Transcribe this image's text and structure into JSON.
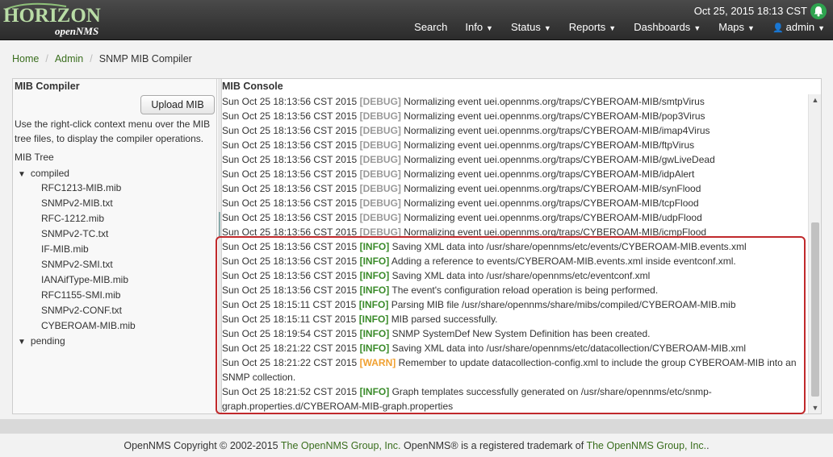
{
  "brand": {
    "logo_main": "HORIZON",
    "logo_sub": "openNMS"
  },
  "header": {
    "datetime": "Oct 25, 2015 18:13 CST",
    "nav": [
      {
        "label": "Search",
        "dropdown": false
      },
      {
        "label": "Info",
        "dropdown": true
      },
      {
        "label": "Status",
        "dropdown": true
      },
      {
        "label": "Reports",
        "dropdown": true
      },
      {
        "label": "Dashboards",
        "dropdown": true
      },
      {
        "label": "Maps",
        "dropdown": true
      },
      {
        "label": "admin",
        "dropdown": true,
        "icon": "user-icon"
      }
    ],
    "notification_icon": "bell-icon",
    "notification_color": "#2ea44f"
  },
  "breadcrumb": {
    "home": "Home",
    "admin": "Admin",
    "current": "SNMP MIB Compiler",
    "separator": "/"
  },
  "mib_panel": {
    "title": "MIB Compiler",
    "upload_label": "Upload MIB",
    "instructions": "Use the right-click context menu over the MIB tree files, to display the compiler operations.",
    "tree_label": "MIB Tree",
    "compiled_label": "compiled",
    "pending_label": "pending",
    "compiled_files": [
      "RFC1213-MIB.mib",
      "SNMPv2-MIB.txt",
      "RFC-1212.mib",
      "SNMPv2-TC.txt",
      "IF-MIB.mib",
      "SNMPv2-SMI.txt",
      "IANAifType-MIB.mib",
      "RFC1155-SMI.mib",
      "SNMPv2-CONF.txt",
      "CYBEROAM-MIB.mib"
    ]
  },
  "console": {
    "title": "MIB Console",
    "lines": [
      {
        "ts": "Sun Oct 25 18:13:56 CST 2015",
        "level": "[DEBUG]",
        "kind": "debug",
        "msg": "Normalizing event uei.opennms.org/traps/CYBEROAM-MIB/smtpVirus"
      },
      {
        "ts": "Sun Oct 25 18:13:56 CST 2015",
        "level": "[DEBUG]",
        "kind": "debug",
        "msg": "Normalizing event uei.opennms.org/traps/CYBEROAM-MIB/pop3Virus"
      },
      {
        "ts": "Sun Oct 25 18:13:56 CST 2015",
        "level": "[DEBUG]",
        "kind": "debug",
        "msg": "Normalizing event uei.opennms.org/traps/CYBEROAM-MIB/imap4Virus"
      },
      {
        "ts": "Sun Oct 25 18:13:56 CST 2015",
        "level": "[DEBUG]",
        "kind": "debug",
        "msg": "Normalizing event uei.opennms.org/traps/CYBEROAM-MIB/ftpVirus"
      },
      {
        "ts": "Sun Oct 25 18:13:56 CST 2015",
        "level": "[DEBUG]",
        "kind": "debug",
        "msg": "Normalizing event uei.opennms.org/traps/CYBEROAM-MIB/gwLiveDead"
      },
      {
        "ts": "Sun Oct 25 18:13:56 CST 2015",
        "level": "[DEBUG]",
        "kind": "debug",
        "msg": "Normalizing event uei.opennms.org/traps/CYBEROAM-MIB/idpAlert"
      },
      {
        "ts": "Sun Oct 25 18:13:56 CST 2015",
        "level": "[DEBUG]",
        "kind": "debug",
        "msg": "Normalizing event uei.opennms.org/traps/CYBEROAM-MIB/synFlood"
      },
      {
        "ts": "Sun Oct 25 18:13:56 CST 2015",
        "level": "[DEBUG]",
        "kind": "debug",
        "msg": "Normalizing event uei.opennms.org/traps/CYBEROAM-MIB/tcpFlood"
      },
      {
        "ts": "Sun Oct 25 18:13:56 CST 2015",
        "level": "[DEBUG]",
        "kind": "debug",
        "msg": "Normalizing event uei.opennms.org/traps/CYBEROAM-MIB/udpFlood"
      },
      {
        "ts": "Sun Oct 25 18:13:56 CST 2015",
        "level": "[DEBUG]",
        "kind": "debug",
        "msg": "Normalizing event uei.opennms.org/traps/CYBEROAM-MIB/icmpFlood"
      },
      {
        "ts": "Sun Oct 25 18:13:56 CST 2015",
        "level": "[INFO]",
        "kind": "info",
        "msg": "Saving XML data into /usr/share/opennms/etc/events/CYBEROAM-MIB.events.xml"
      },
      {
        "ts": "Sun Oct 25 18:13:56 CST 2015",
        "level": "[INFO]",
        "kind": "info",
        "msg": "Adding a reference to events/CYBEROAM-MIB.events.xml inside eventconf.xml."
      },
      {
        "ts": "Sun Oct 25 18:13:56 CST 2015",
        "level": "[INFO]",
        "kind": "info",
        "msg": "Saving XML data into /usr/share/opennms/etc/eventconf.xml"
      },
      {
        "ts": "Sun Oct 25 18:13:56 CST 2015",
        "level": "[INFO]",
        "kind": "info",
        "msg": "The event's configuration reload operation is being performed."
      },
      {
        "ts": "Sun Oct 25 18:15:11 CST 2015",
        "level": "[INFO]",
        "kind": "info",
        "msg": "Parsing MIB file /usr/share/opennms/share/mibs/compiled/CYBEROAM-MIB.mib"
      },
      {
        "ts": "Sun Oct 25 18:15:11 CST 2015",
        "level": "[INFO]",
        "kind": "info",
        "msg": "MIB parsed successfully."
      },
      {
        "ts": "Sun Oct 25 18:19:54 CST 2015",
        "level": "[INFO]",
        "kind": "info",
        "msg": "SNMP SystemDef New System Definition has been created."
      },
      {
        "ts": "Sun Oct 25 18:21:22 CST 2015",
        "level": "[INFO]",
        "kind": "info",
        "msg": "Saving XML data into /usr/share/opennms/etc/datacollection/CYBEROAM-MIB.xml"
      },
      {
        "ts": "Sun Oct 25 18:21:22 CST 2015",
        "level": "[WARN]",
        "kind": "warn",
        "msg": "Remember to update datacollection-config.xml to include the group CYBEROAM-MIB into an SNMP collection."
      },
      {
        "ts": "Sun Oct 25 18:21:52 CST 2015",
        "level": "[INFO]",
        "kind": "info",
        "msg": "Graph templates successfully generated on /usr/share/opennms/etc/snmp-graph.properties.d/CYBEROAM-MIB-graph.properties"
      }
    ]
  },
  "footer": {
    "prefix": "OpenNMS Copyright © 2002-2015",
    "group1": "The OpenNMS Group, Inc.",
    "middle": "OpenNMS® is a registered trademark of",
    "group2": "The OpenNMS Group, Inc."
  },
  "colors": {
    "highlight": "#c0292b",
    "info": "#3a8b2a",
    "debug": "#999999",
    "warn": "#f0a030",
    "link": "#3a6e1e"
  }
}
